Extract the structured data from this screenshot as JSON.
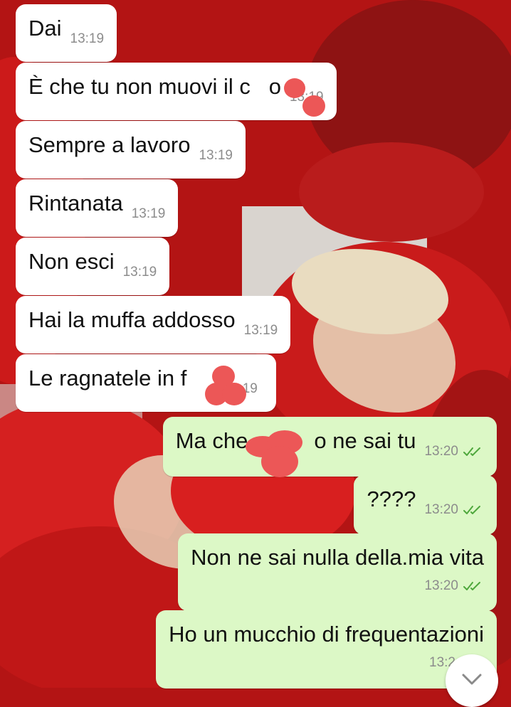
{
  "messages": [
    {
      "text": "Dai",
      "time": "13:19",
      "direction": "incoming"
    },
    {
      "text": "È che tu non muovi il c   o",
      "time": "13:19",
      "direction": "incoming"
    },
    {
      "text": "Sempre a lavoro",
      "time": "13:19",
      "direction": "incoming"
    },
    {
      "text": "Rintanata",
      "time": "13:19",
      "direction": "incoming"
    },
    {
      "text": "Non esci",
      "time": "13:19",
      "direction": "incoming"
    },
    {
      "text": "Hai la muffa addosso",
      "time": "13:19",
      "direction": "incoming"
    },
    {
      "text": "Le ragnatele in f",
      "time": "13:19",
      "direction": "incoming"
    },
    {
      "text": "Ma che ca      o ne sai tu",
      "time": "13:20",
      "direction": "outgoing",
      "status": "read"
    },
    {
      "text": "????",
      "time": "13:20",
      "direction": "outgoing",
      "status": "read"
    },
    {
      "text": "Non ne sai nulla della.mia vita",
      "time": "13:20",
      "direction": "outgoing",
      "status": "read"
    },
    {
      "text": "Ho un mucchio di frequentazioni",
      "time": "13:2",
      "direction": "outgoing",
      "status": "read"
    }
  ],
  "colors": {
    "incoming_bubble": "#ffffff",
    "outgoing_bubble": "#dcf8c6",
    "read_tick": "#4fa83d",
    "censor_scribble": "#ec5757",
    "wallpaper": "#b31414"
  },
  "icons": {
    "read_receipt": "double-check-icon",
    "scroll_down": "chevron-down-icon"
  }
}
